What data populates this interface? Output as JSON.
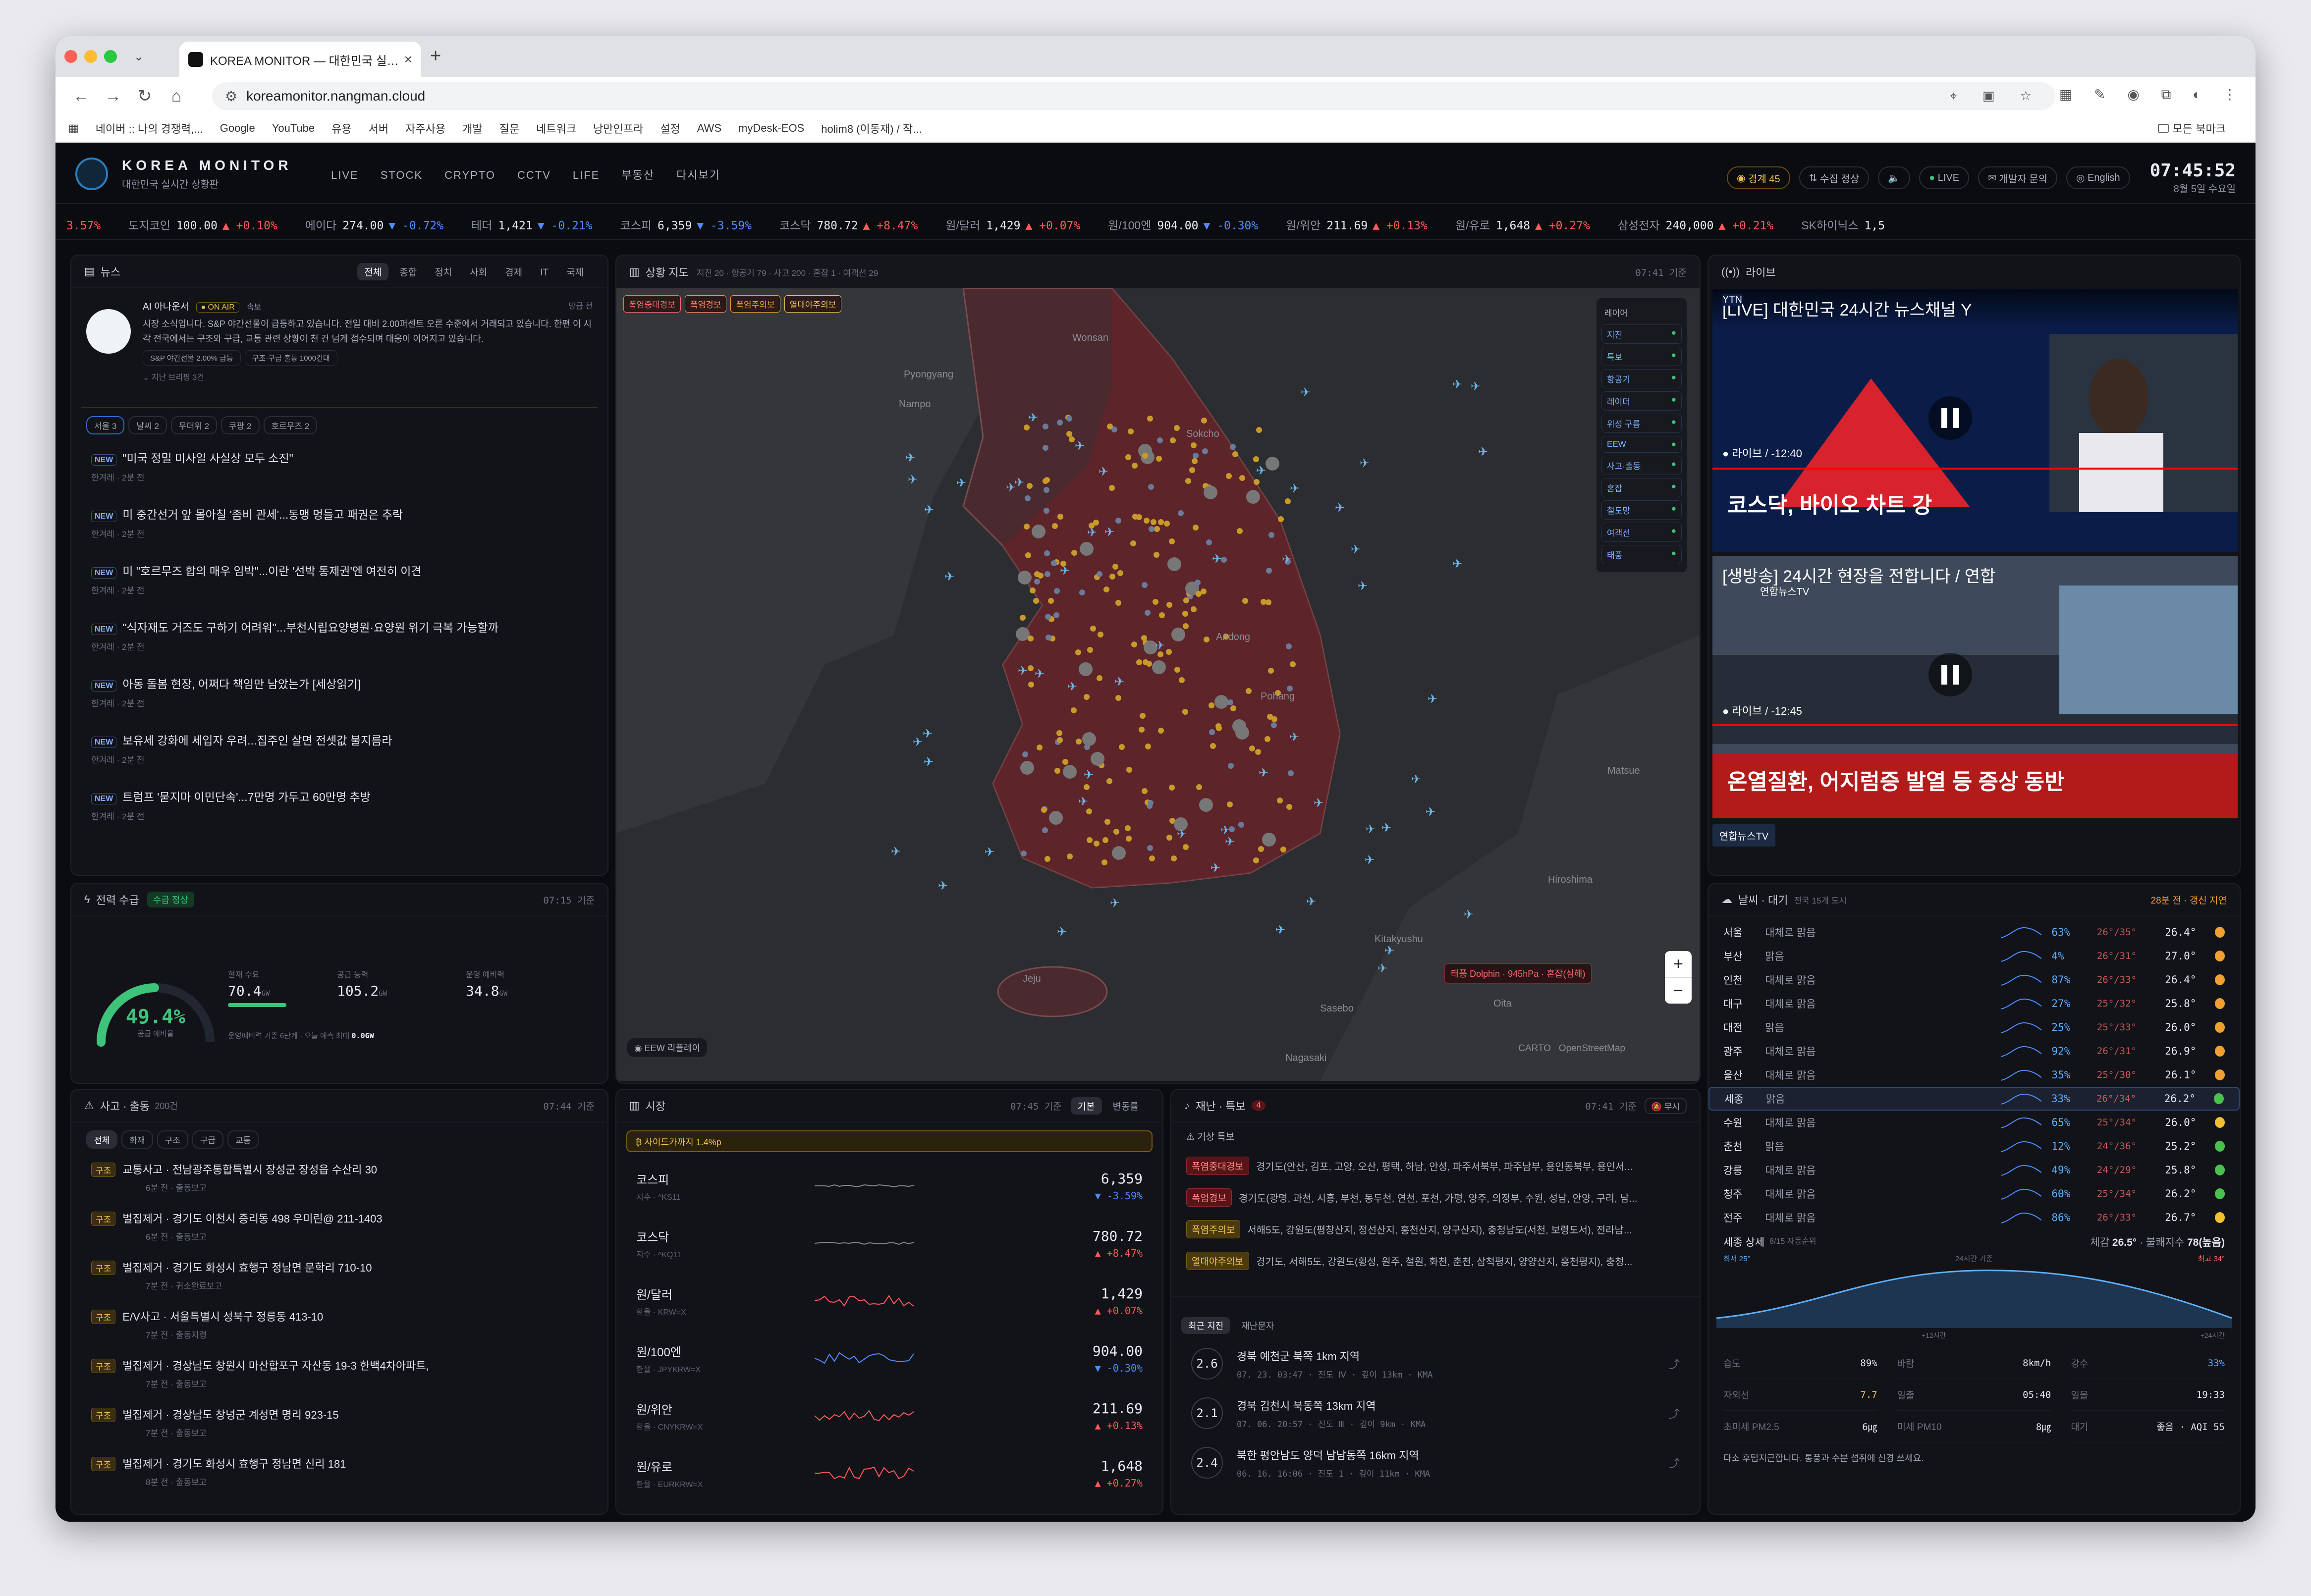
{
  "browser": {
    "tab_title": "KOREA MONITOR — 대한민국 실…",
    "url": "koreamonitor.nangman.cloud",
    "bookmarks": [
      "네이버 :: 나의 경쟁력,...",
      "Google",
      "YouTube",
      "유용",
      "서버",
      "자주사용",
      "개발",
      "질문",
      "네트워크",
      "낭만인프라",
      "설정",
      "AWS",
      "myDesk-EOS",
      "holim8 (이동재) / 작..."
    ],
    "bookmarks_right": "모든 북마크"
  },
  "header": {
    "brand": "KOREA MONITOR",
    "subtitle": "대한민국 실시간 상황판",
    "nav": [
      "LIVE",
      "STOCK",
      "CRYPTO",
      "CCTV",
      "LIFE",
      "부동산",
      "다시보기"
    ],
    "alert_pill": "경계 45",
    "status_pill": "수집 정상",
    "live_pill": "LIVE",
    "dev_pill": "개발자 문의",
    "lang_pill": "English",
    "time": "07:45:52",
    "date": "8월 5일 수요일"
  },
  "ticker": [
    {
      "name": "",
      "value": "",
      "change": "3.57%",
      "dir": "up"
    },
    {
      "name": "도지코인",
      "value": "100.00",
      "change": "▲ +0.10%",
      "dir": "up"
    },
    {
      "name": "에이다",
      "value": "274.00",
      "change": "▼ -0.72%",
      "dir": "dn"
    },
    {
      "name": "테더",
      "value": "1,421",
      "change": "▼ -0.21%",
      "dir": "dn"
    },
    {
      "name": "코스피",
      "value": "6,359",
      "change": "▼ -3.59%",
      "dir": "dn"
    },
    {
      "name": "코스닥",
      "value": "780.72",
      "change": "▲ +8.47%",
      "dir": "up"
    },
    {
      "name": "원/달러",
      "value": "1,429",
      "change": "▲ +0.07%",
      "dir": "up"
    },
    {
      "name": "원/100엔",
      "value": "904.00",
      "change": "▼ -0.30%",
      "dir": "dn"
    },
    {
      "name": "원/위안",
      "value": "211.69",
      "change": "▲ +0.13%",
      "dir": "up"
    },
    {
      "name": "원/유로",
      "value": "1,648",
      "change": "▲ +0.27%",
      "dir": "up"
    },
    {
      "name": "삼성전자",
      "value": "240,000",
      "change": "▲ +0.21%",
      "dir": "up"
    },
    {
      "name": "SK하이닉스",
      "value": "1,5",
      "change": "",
      "dir": "up"
    }
  ],
  "news": {
    "title": "뉴스",
    "tabs": [
      "전체",
      "종합",
      "정치",
      "사회",
      "경제",
      "IT",
      "국제"
    ],
    "ai_name": "AI 아나운서",
    "ai_badge": "● ON AIR",
    "ai_badge2": "속보",
    "ai_time": "방금 전",
    "ai_text": "시장 소식입니다. S&P 야간선물이 급등하고 있습니다. 전일 대비 2.00퍼센트 오른 수준에서 거래되고 있습니다. 한편 이 시각 전국에서는 구조와 구급, 교통 관련 상황이 천 건 넘게 접수되며 대응이 이어지고 있습니다.",
    "ai_tags": [
      "S&P 야간선물 2.00% 급등",
      "구조·구급 출동 1000건대"
    ],
    "ai_more": "지난 브리핑 3건",
    "regions": [
      "서울 3",
      "날씨 2",
      "무더위 2",
      "쿠팡 2",
      "호르무즈 2"
    ],
    "items": [
      {
        "title": "\"미국 정밀 미사일 사실상 모두 소진\"",
        "meta": "한겨레 · 2분 전"
      },
      {
        "title": "미 중간선거 앞 몰아칠 '좀비 관세'...동맹 멍들고 패권은 추락",
        "meta": "한겨레 · 2분 전"
      },
      {
        "title": "미 \"호르무즈 합의 매우 임박\"...이란 '선박 통제권'엔 여전히 이견",
        "meta": "한겨레 · 2분 전"
      },
      {
        "title": "\"식자재도 거즈도 구하기 어려워\"...부천시립요양병원·요양원 위기 극복 가능할까",
        "meta": "한겨레 · 2분 전"
      },
      {
        "title": "아동 돌봄 현장, 어쩌다 책임만 남았는가 [세상읽기]",
        "meta": "한겨레 · 2분 전"
      },
      {
        "title": "보유세 강화에 세입자 우려...집주인 살면 전셋값 불지름라",
        "meta": "한겨레 · 2분 전"
      },
      {
        "title": "트럼프 '묻지마 이민단속'...7만명 가두고 60만명 추방",
        "meta": "한겨레 · 2분 전"
      }
    ],
    "new_label": "NEW"
  },
  "power": {
    "title": "전력 수급",
    "badge": "수급 정상",
    "time": "07:15 기준",
    "ratio": "49.4%",
    "ratio_label": "공급 예비율",
    "ratio_value": 0.494,
    "demand_label": "현재 수요",
    "demand": "70.4",
    "supply_label": "공급 능력",
    "supply": "105.2",
    "reserve_label": "운영 예비력",
    "reserve": "34.8",
    "unit": "GW",
    "note": "운영예비력 기준 6단계 · 오늘 예측 최대",
    "note_val": "0.0GW"
  },
  "map": {
    "title": "상황 지도",
    "sub": "지진 20 · 항공기 79 · 사고 200 · 혼잡 1 · 여객선 29",
    "time": "07:41 기준",
    "alerts": [
      "폭염중대경보",
      "폭염경보",
      "폭염주의보",
      "열대야주의보"
    ],
    "layers_title": "레이어",
    "layers": [
      "지진",
      "특보",
      "항공기",
      "레이더",
      "위성 구름",
      "EEW",
      "사고·출동",
      "혼잡",
      "철도망",
      "여객선",
      "태풍"
    ],
    "places": [
      "Wonsan",
      "Pyongyang",
      "Nampo",
      "Sokcho",
      "Andong",
      "Pohang",
      "Matsue",
      "Hiroshima",
      "Kitakyushu",
      "Sasebo",
      "Oita",
      "Jeju",
      "Nagasaki"
    ],
    "typhoon": "태풍 Dolphin · 945hPa · 혼잡(심해)",
    "eew": "EEW 리플레이",
    "attrib": [
      "CARTO",
      "OpenStreetMap"
    ]
  },
  "live": {
    "title": "라이브",
    "v1_title": "[LIVE] 대한민국 24시간 뉴스채널 Y",
    "v1_channel": "YTN",
    "v1_time": "라이브 / -12:40",
    "v1_caption": "코스닥, 바이오 차트 강",
    "v2_title": "[생방송] 24시간 현장을 전합니다 / 연합",
    "v2_channel": "연합뉴스TV",
    "v2_time": "라이브 / -12:45",
    "v2_caption": "온열질환, 어지럼증 발열 등 증상 동반",
    "footer": "연합뉴스TV"
  },
  "weather": {
    "title": "날씨 · 대기",
    "sub": "전국 15개 도시",
    "status": "28분 전 · 갱신 지연",
    "rows": [
      {
        "city": "서울",
        "sky": "대체로 맑음",
        "hum": "63%",
        "range": "26°/35°",
        "temp": "26.4°",
        "c": "#f0a030"
      },
      {
        "city": "부산",
        "sky": "맑음",
        "hum": "4%",
        "range": "26°/31°",
        "temp": "27.0°",
        "c": "#f0a030"
      },
      {
        "city": "인천",
        "sky": "대체로 맑음",
        "hum": "87%",
        "range": "26°/33°",
        "temp": "26.4°",
        "c": "#f0a030"
      },
      {
        "city": "대구",
        "sky": "대체로 맑음",
        "hum": "27%",
        "range": "25°/32°",
        "temp": "25.8°",
        "c": "#f0a030"
      },
      {
        "city": "대전",
        "sky": "맑음",
        "hum": "25%",
        "range": "25°/33°",
        "temp": "26.0°",
        "c": "#f0a030"
      },
      {
        "city": "광주",
        "sky": "대체로 맑음",
        "hum": "92%",
        "range": "26°/31°",
        "temp": "26.9°",
        "c": "#f0a030"
      },
      {
        "city": "울산",
        "sky": "대체로 맑음",
        "hum": "35%",
        "range": "25°/30°",
        "temp": "26.1°",
        "c": "#f0a030"
      },
      {
        "city": "세종",
        "sky": "맑음",
        "hum": "33%",
        "range": "26°/34°",
        "temp": "26.2°",
        "c": "#4cc04c"
      },
      {
        "city": "수원",
        "sky": "대체로 맑음",
        "hum": "65%",
        "range": "25°/34°",
        "temp": "26.0°",
        "c": "#f0c030"
      },
      {
        "city": "춘천",
        "sky": "맑음",
        "hum": "12%",
        "range": "24°/36°",
        "temp": "25.2°",
        "c": "#4cc04c"
      },
      {
        "city": "강릉",
        "sky": "대체로 맑음",
        "hum": "49%",
        "range": "24°/29°",
        "temp": "25.8°",
        "c": "#4cc04c"
      },
      {
        "city": "청주",
        "sky": "대체로 맑음",
        "hum": "60%",
        "range": "25°/34°",
        "temp": "26.2°",
        "c": "#4cc04c"
      },
      {
        "city": "전주",
        "sky": "대체로 맑음",
        "hum": "86%",
        "range": "26°/33°",
        "temp": "26.7°",
        "c": "#f0c030"
      }
    ],
    "detail_title": "세종 상세",
    "detail_date": "8/15 자동순위",
    "feel_label": "체감",
    "feel": "26.5°",
    "discomfort_label": "불쾌지수",
    "discomfort": "78(높음)",
    "chart_min": "최저 25°",
    "chart_max": "최고 34°",
    "chart_mid": "24시간 기준",
    "chart_x": [
      "+12시간",
      "+24시간"
    ],
    "stats": [
      {
        "k": "습도",
        "v": "89%"
      },
      {
        "k": "바람",
        "v": "8km/h"
      },
      {
        "k": "강수",
        "v": "33%"
      },
      {
        "k": "자외선",
        "v": "7.7"
      },
      {
        "k": "일출",
        "v": "05:40"
      },
      {
        "k": "일몰",
        "v": "19:33"
      },
      {
        "k": "초미세 PM2.5",
        "v": "6㎍"
      },
      {
        "k": "미세 PM10",
        "v": "8㎍"
      },
      {
        "k": "대기",
        "v": "좋음 · AQI 55"
      }
    ],
    "tip": "다소 후텁지근합니다. 통풍과 수분 섭취에 신경 쓰세요."
  },
  "incidents": {
    "title": "사고 · 출동",
    "count": "200건",
    "time": "07:44 기준",
    "tabs": [
      "전체",
      "화재",
      "구조",
      "구급",
      "교통"
    ],
    "tag": "구조",
    "items": [
      {
        "title": "교통사고 · 전남광주통합특별시 장성군 장성읍 수산리 30",
        "meta": "6분 전 · 출동보고"
      },
      {
        "title": "벌집제거 · 경기도 이천시 증리동 498 우미린@ 211-1403",
        "meta": "6분 전 · 출동보고"
      },
      {
        "title": "벌집제거 · 경기도 화성시 효행구 정남면 문학리 710-10",
        "meta": "7분 전 · 귀소완료보고"
      },
      {
        "title": "E/V사고 · 서울특별시 성북구 정릉동 413-10",
        "meta": "7분 전 · 출동지령"
      },
      {
        "title": "벌집제거 · 경상남도 창원시 마산합포구 자산동 19-3 한백4차아파트,",
        "meta": "7분 전 · 출동보고"
      },
      {
        "title": "벌집제거 · 경상남도 창녕군 계성면 명리 923-15",
        "meta": "7분 전 · 출동보고"
      },
      {
        "title": "벌집제거 · 경기도 화성시 효행구 정남면 신리 181",
        "meta": "8분 전 · 출동보고"
      }
    ]
  },
  "market": {
    "title": "시장",
    "time": "07:45 기준",
    "tabs": [
      "기본",
      "변동률"
    ],
    "banner": "사이드카까지 1.4%p",
    "rows": [
      {
        "name": "코스피",
        "sub": "지수 · ^KS11",
        "value": "6,359",
        "change": "▼ -3.59%",
        "dir": "dn"
      },
      {
        "name": "코스닥",
        "sub": "지수 · ^KQ11",
        "value": "780.72",
        "change": "▲ +8.47%",
        "dir": "up"
      },
      {
        "name": "원/달러",
        "sub": "환율 · KRW=X",
        "value": "1,429",
        "change": "▲ +0.07%",
        "dir": "up"
      },
      {
        "name": "원/100엔",
        "sub": "환율 · JPYKRW=X",
        "value": "904.00",
        "change": "▼ -0.30%",
        "dir": "dn"
      },
      {
        "name": "원/위안",
        "sub": "환율 · CNYKRW=X",
        "value": "211.69",
        "change": "▲ +0.13%",
        "dir": "up"
      },
      {
        "name": "원/유로",
        "sub": "환율 · EURKRW=X",
        "value": "1,648",
        "change": "▲ +0.27%",
        "dir": "up"
      }
    ]
  },
  "disaster": {
    "title": "재난 · 특보",
    "count": "4",
    "time": "07:41 기준",
    "mute": "무시",
    "section": "기상 특보",
    "alerts": [
      {
        "label": "폭염중대경보",
        "text": "경기도(안산, 김포, 고양, 오산, 평택, 하남, 안성, 파주서북부, 파주남부, 용인동북부, 용인서...",
        "y": false
      },
      {
        "label": "폭염경보",
        "text": "경기도(광명, 과천, 시흥, 부천, 동두천, 연천, 포천, 가평, 양주, 의정부, 수원, 성남, 안양, 구리, 남...",
        "y": false
      },
      {
        "label": "폭염주의보",
        "text": "서해5도, 강원도(평창산지, 정선산지, 홍천산지, 양구산지), 충청남도(서천, 보령도서), 전라남...",
        "y": true
      },
      {
        "label": "열대야주의보",
        "text": "경기도, 서해5도, 강원도(횡성, 원주, 철원, 화천, 춘천, 삼척평지, 양양산지, 홍천평지), 충청...",
        "y": true
      }
    ],
    "tabs": [
      "최근 지진",
      "재난문자"
    ],
    "quakes": [
      {
        "mag": "2.6",
        "title": "경북 예천군 북쪽 1km 지역",
        "meta": "07. 23. 03:47 · 진도 Ⅳ · 깊이 13km · KMA"
      },
      {
        "mag": "2.1",
        "title": "경북 김천시 북동쪽 13km 지역",
        "meta": "07. 06. 20:57 · 진도 Ⅲ · 깊이 9km · KMA"
      },
      {
        "mag": "2.4",
        "title": "북한 평안남도 양덕 남남동쪽 16km 지역",
        "meta": "06. 16. 16:06 · 진도 1 · 깊이 11km · KMA"
      }
    ]
  },
  "colors": {
    "accent": "#2a7dbe",
    "up": "#ff5b5b",
    "down": "#4f8dff",
    "warn": "#f2c14e",
    "ok": "#3ec37a"
  }
}
